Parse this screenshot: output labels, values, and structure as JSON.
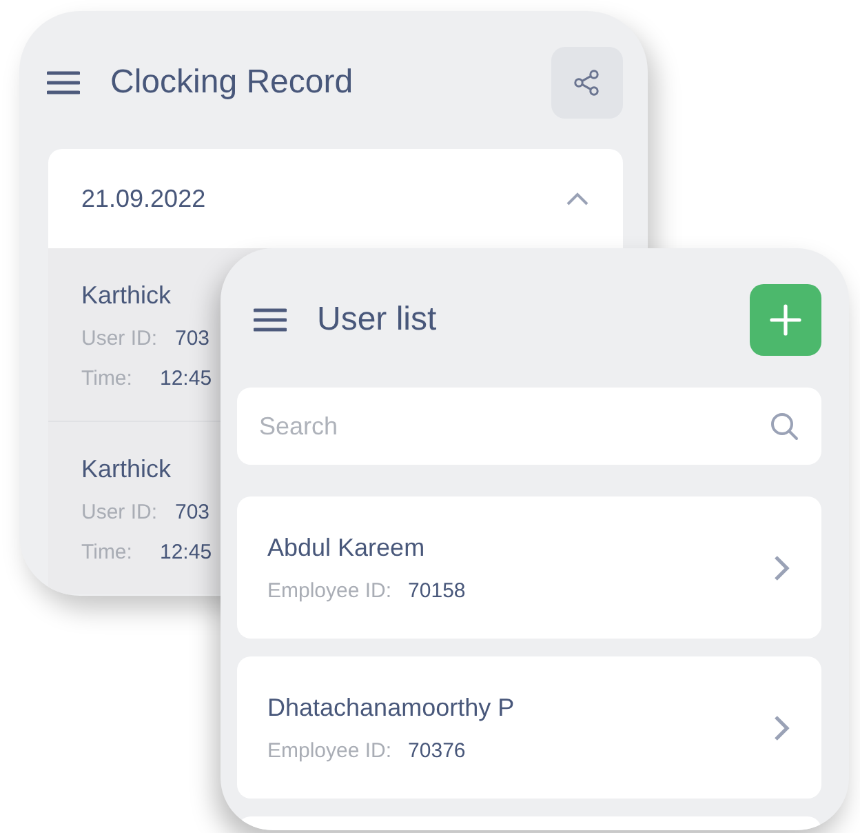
{
  "clocking_screen": {
    "title": "Clocking Record",
    "date_group": {
      "date": "21.09.2022",
      "expanded": true
    },
    "records": [
      {
        "name": "Karthick",
        "user_id_label": "User ID:",
        "user_id": "703",
        "time_label": "Time:",
        "time": "12:45"
      },
      {
        "name": "Karthick",
        "user_id_label": "User ID:",
        "user_id": "703",
        "time_label": "Time:",
        "time": "12:45"
      }
    ]
  },
  "user_list_screen": {
    "title": "User list",
    "search": {
      "placeholder": "Search"
    },
    "users": [
      {
        "name": "Abdul Kareem",
        "id_label": "Employee ID:",
        "id": "70158"
      },
      {
        "name": "Dhatachanamoorthy P",
        "id_label": "Employee ID:",
        "id": "70376"
      }
    ]
  }
}
